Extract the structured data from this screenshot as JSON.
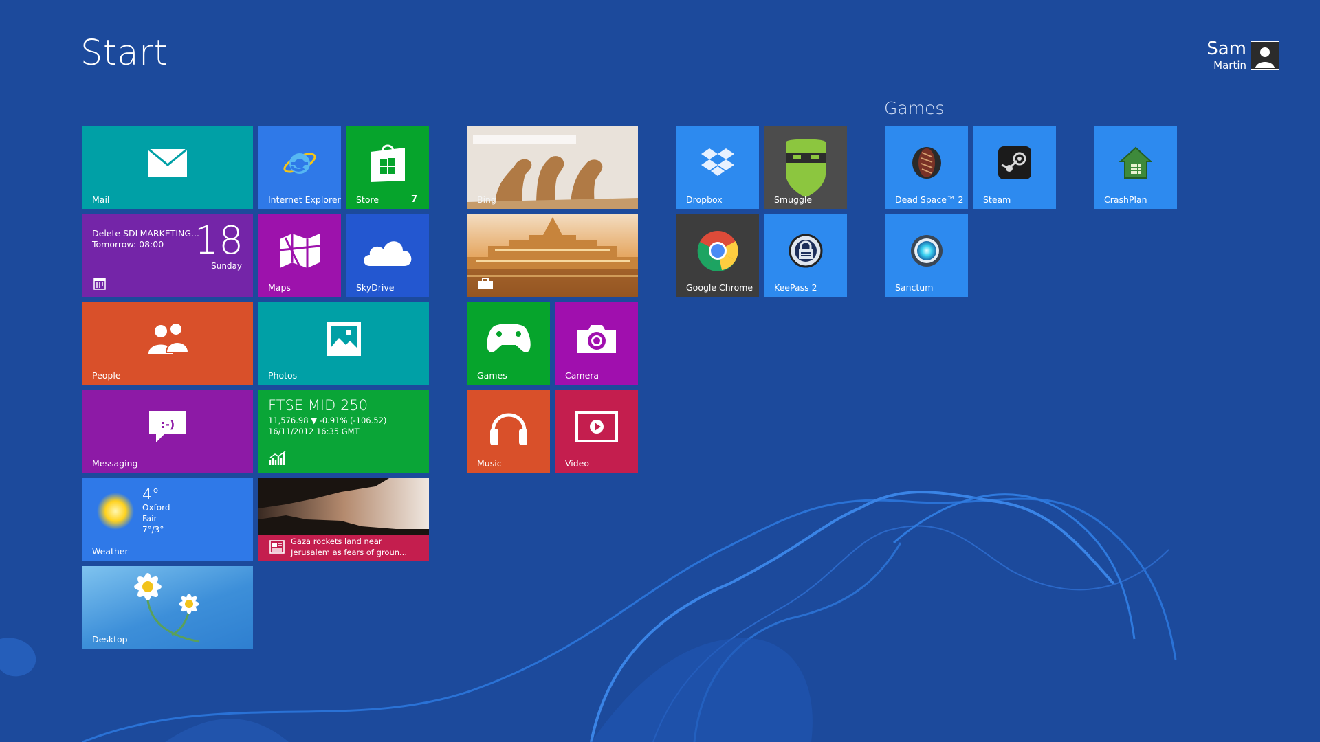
{
  "screen": {
    "title": "Start"
  },
  "user": {
    "first_name": "Sam",
    "last_name": "Martin"
  },
  "groups": {
    "games_title": "Games"
  },
  "tiles": {
    "mail": {
      "label": "Mail",
      "icon": "mail-icon"
    },
    "ie": {
      "label": "Internet Explorer",
      "icon": "ie-icon"
    },
    "store": {
      "label": "Store",
      "badge": "7",
      "icon": "store-icon"
    },
    "bing": {
      "label": "Bing"
    },
    "calendar": {
      "event": "Delete SDLMARKETING...",
      "time": "Tomorrow: 08:00",
      "day_number": "18",
      "day_name": "Sunday"
    },
    "maps": {
      "label": "Maps"
    },
    "skydrive": {
      "label": "SkyDrive"
    },
    "travel": {
      "label": ""
    },
    "people": {
      "label": "People"
    },
    "photos": {
      "label": "Photos"
    },
    "games": {
      "label": "Games"
    },
    "camera": {
      "label": "Camera"
    },
    "messaging": {
      "label": "Messaging"
    },
    "finance": {
      "index": "FTSE MID 250",
      "value": "11,576.98",
      "change": "-0.91% (-106.52)",
      "timestamp": "16/11/2012 16:35 GMT"
    },
    "music": {
      "label": "Music"
    },
    "video": {
      "label": "Video"
    },
    "weather": {
      "label": "Weather",
      "temp": "4°",
      "city": "Oxford",
      "condition": "Fair",
      "range": "7°/3°"
    },
    "news": {
      "headline_line1": "Gaza rockets land near",
      "headline_line2": "Jerusalem as fears of groun..."
    },
    "desktop": {
      "label": "Desktop"
    },
    "dropbox": {
      "label": "Dropbox"
    },
    "smuggle": {
      "label": "Smuggle"
    },
    "chrome": {
      "label": "Google Chrome"
    },
    "keepass": {
      "label": "KeePass 2"
    },
    "deadspace": {
      "label": "Dead Space™ 2"
    },
    "steam": {
      "label": "Steam"
    },
    "crashplan": {
      "label": "CrashPlan"
    },
    "sanctum": {
      "label": "Sanctum"
    }
  },
  "colors": {
    "background": "#1c4a9c",
    "teal": "#00a0a6",
    "blue": "#2f79e8",
    "green": "#06a42c",
    "purple": "#7425a8",
    "magenta": "#a00fae",
    "orange": "#d9502a",
    "crimson": "#c41e4e"
  }
}
